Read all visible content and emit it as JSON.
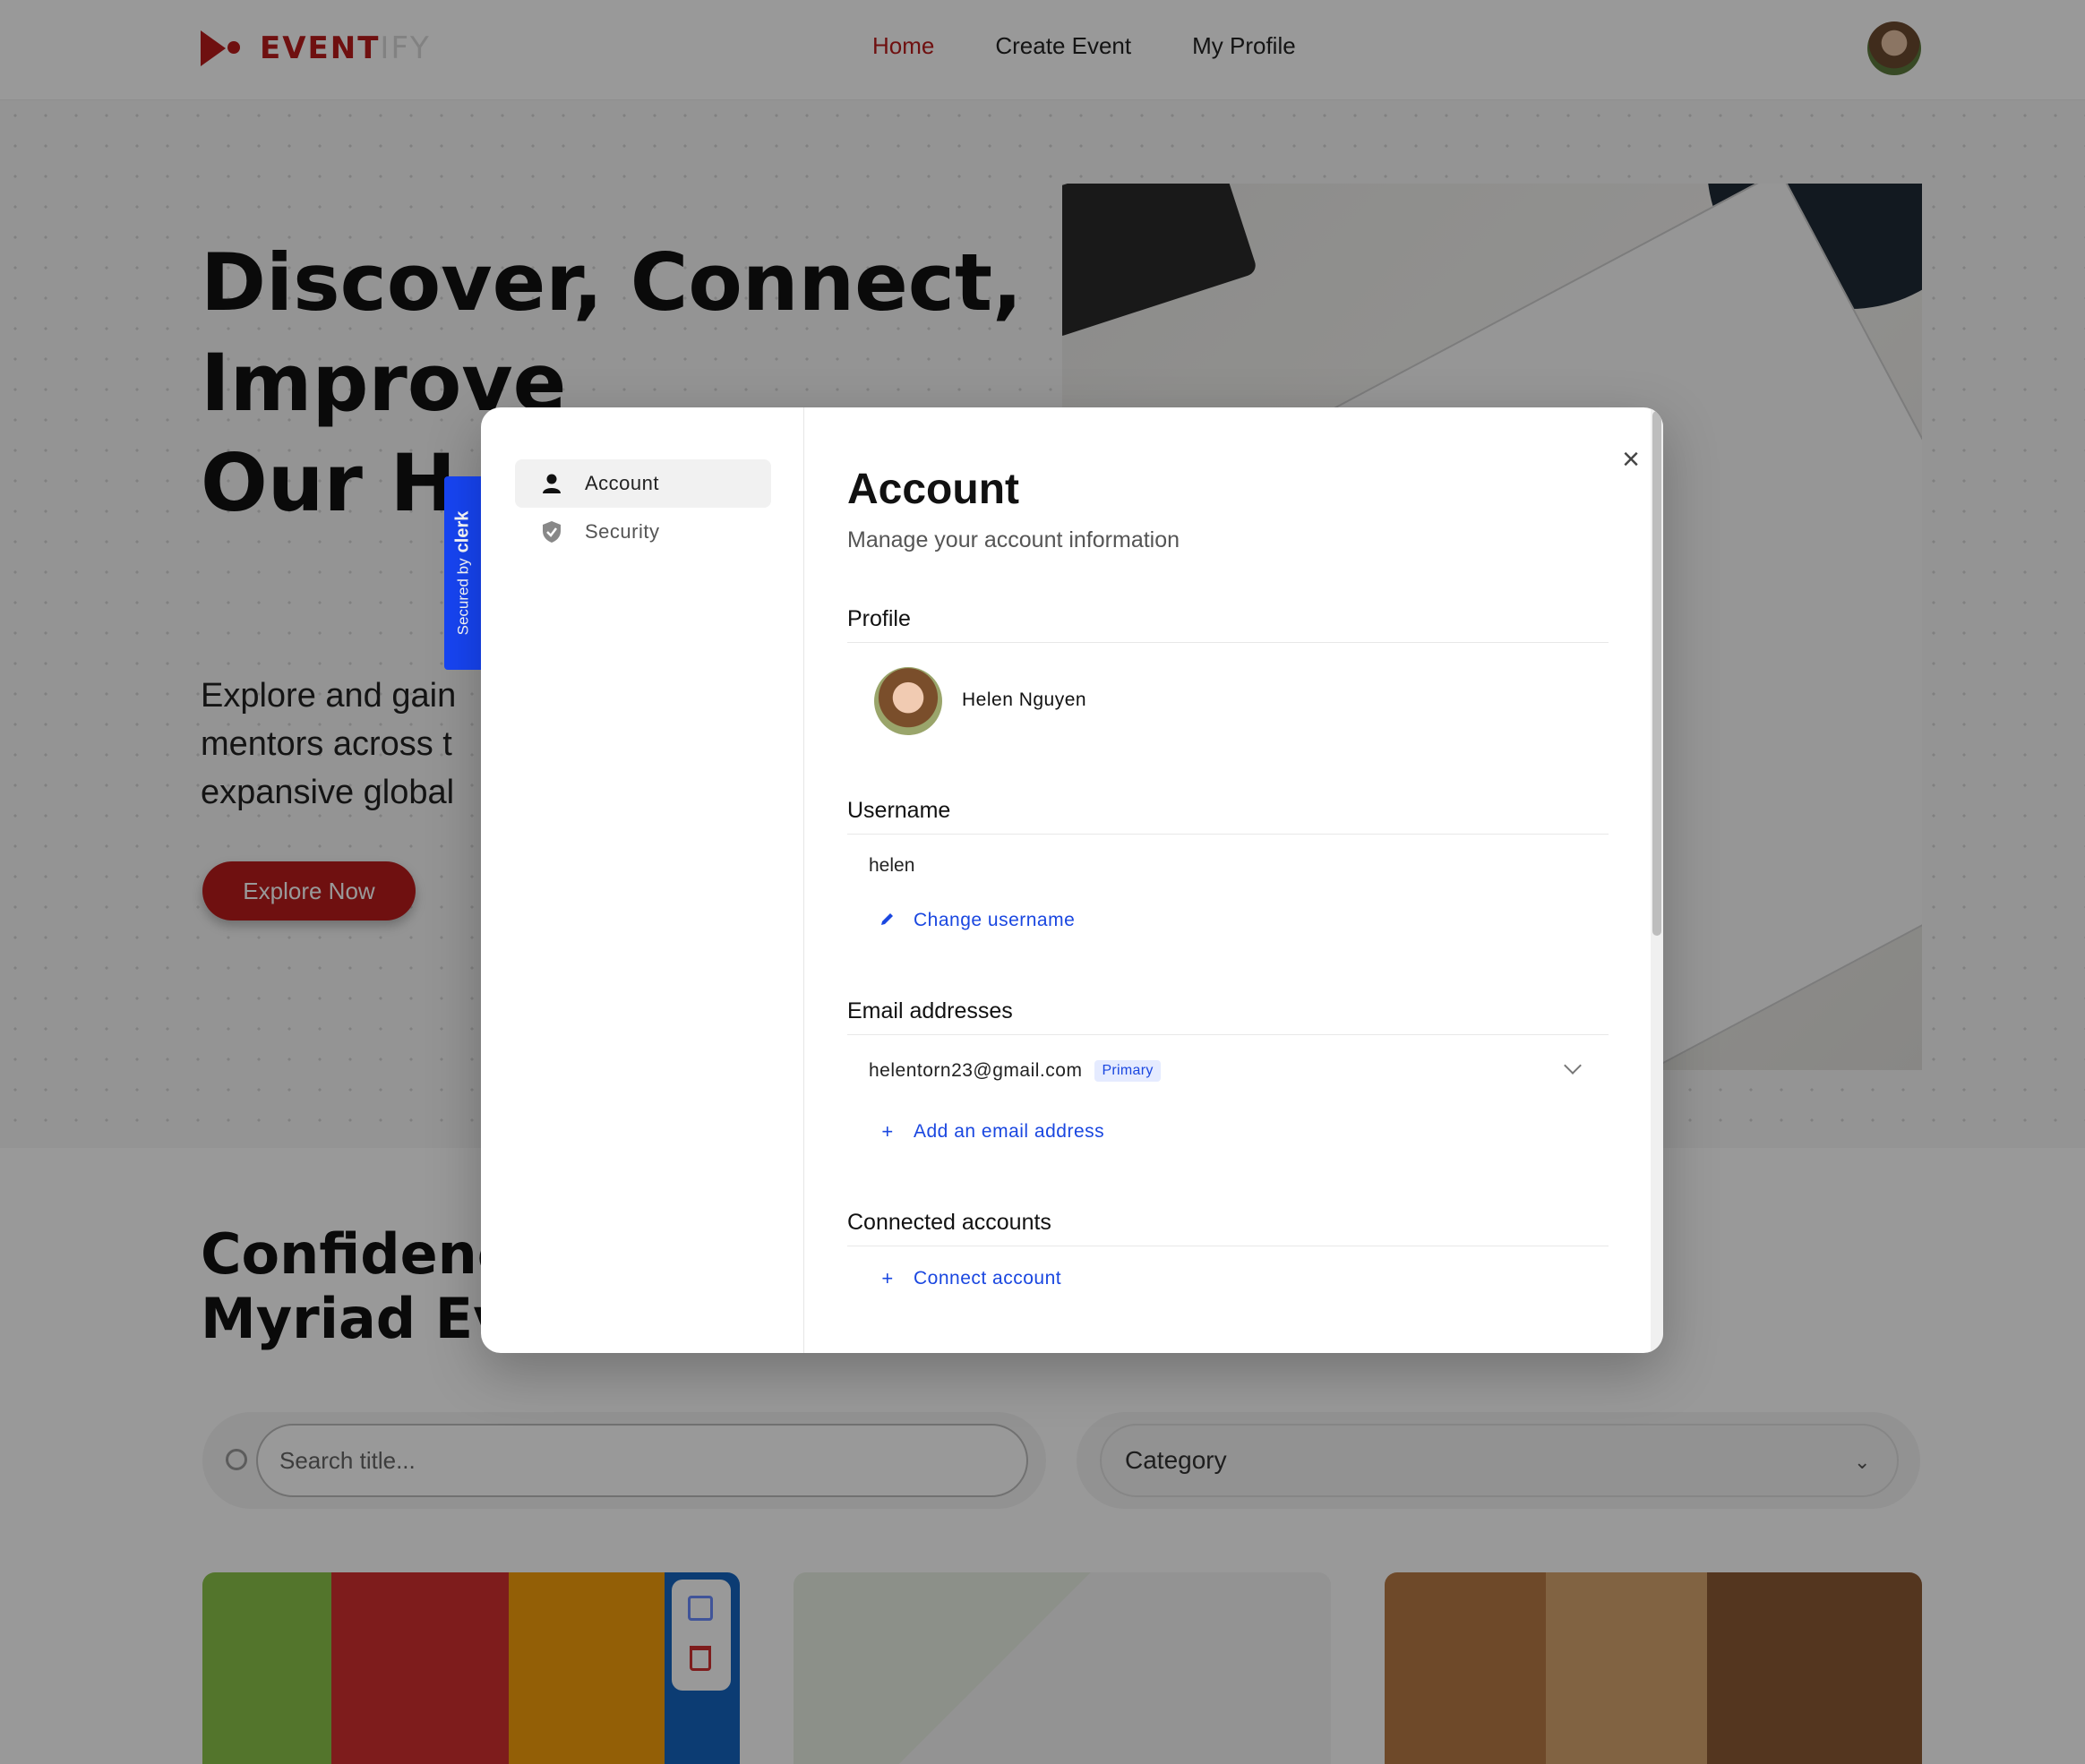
{
  "app": {
    "logo_text_main": "EVENT",
    "logo_text_light": "IFY",
    "nav": [
      "Home",
      "Create Event",
      "My Profile"
    ]
  },
  "hero": {
    "title_lines": [
      "Discover, Connect,",
      "Improve",
      "Our H"
    ],
    "description_lines": [
      "Explore and gain",
      "mentors across t",
      "expansive global"
    ],
    "button_label": "Explore Now"
  },
  "section": {
    "title_lines": [
      "Confidence",
      "Myriad Eve"
    ],
    "search_placeholder": "Search title...",
    "category_label": "Category"
  },
  "clerk": {
    "secured_by": "Secured by",
    "brand": "clerk"
  },
  "modal": {
    "sidebar": [
      {
        "label": "Account",
        "icon": "person-icon",
        "active": true
      },
      {
        "label": "Security",
        "icon": "shield-icon",
        "active": false
      }
    ],
    "title": "Account",
    "subtitle": "Manage your account information",
    "close_icon": "×",
    "profile": {
      "section_title": "Profile",
      "name": "Helen Nguyen"
    },
    "username": {
      "section_title": "Username",
      "value": "helen",
      "action": "Change username"
    },
    "emails": {
      "section_title": "Email addresses",
      "address": "helentorn23@gmail.com",
      "badge": "Primary",
      "action": "Add an email address"
    },
    "connected": {
      "section_title": "Connected accounts",
      "action": "Connect account"
    }
  },
  "colors": {
    "brand": "#b91c1c",
    "link": "#1a47e0",
    "clerk_badge": "#1745f5"
  }
}
